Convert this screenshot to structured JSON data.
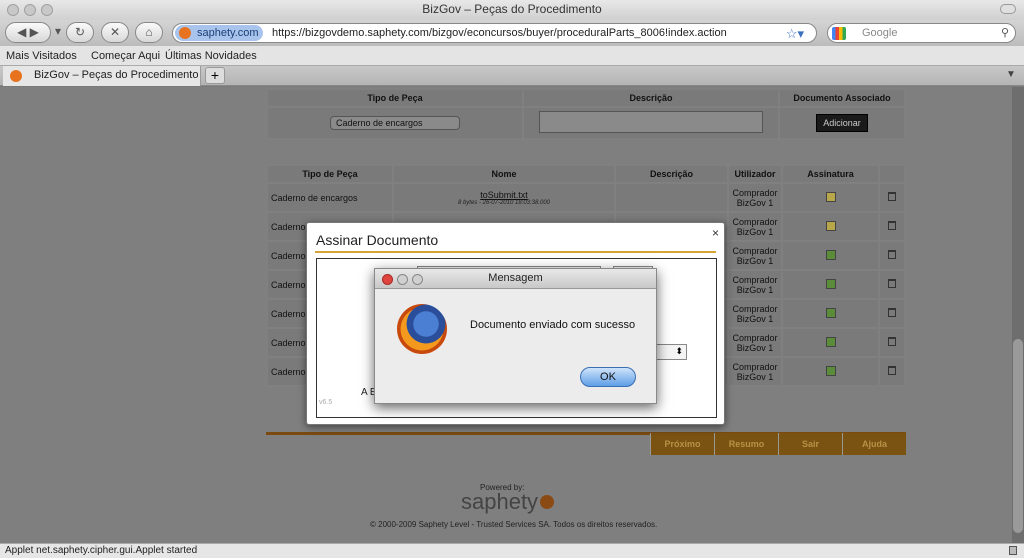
{
  "window": {
    "title": "BizGov – Peças do Procedimento"
  },
  "toolbar": {
    "back_icon": "back-arrow-icon",
    "forward_icon": "forward-arrow-icon",
    "site_name": "saphety.com",
    "url": "https://bizgovdemo.saphety.com/bizgov/econcursos/buyer/proceduralParts_8006!index.action",
    "search_placeholder": "Google"
  },
  "bookmarks": {
    "items": [
      "Mais Visitados",
      "Começar Aqui",
      "Últimas Novidades"
    ]
  },
  "tabs": {
    "active_title": "BizGov – Peças do Procedimento",
    "new_tab": "+"
  },
  "add_form": {
    "headers": [
      "Tipo de Peça",
      "Descrição",
      "Documento Associado"
    ],
    "select_value": "Caderno de encargos",
    "add_label": "Adicionar"
  },
  "parts_table": {
    "headers": [
      "Tipo de Peça",
      "Nome",
      "Descrição",
      "Utilizador",
      "Assinatura"
    ],
    "rows": [
      {
        "tipo": "Caderno de encargos",
        "nome": "toSubmit.txt",
        "info": "8 bytes - 26-07-2010 18:03:38.000",
        "user": "Comprador BizGov 1",
        "sig": "pending"
      },
      {
        "tipo": "Caderno",
        "nome": "",
        "info": "",
        "user": "Comprador BizGov 1",
        "sig": "pending"
      },
      {
        "tipo": "Caderno",
        "nome": "",
        "info": "",
        "user": "Comprador BizGov 1",
        "sig": "signed"
      },
      {
        "tipo": "Caderno",
        "nome": "",
        "info": "",
        "user": "Comprador BizGov 1",
        "sig": "signed"
      },
      {
        "tipo": "Caderno",
        "nome": "",
        "info": "",
        "user": "Comprador BizGov 1",
        "sig": "signed"
      },
      {
        "tipo": "Caderno",
        "nome": "",
        "info": "",
        "user": "Comprador BizGov 1",
        "sig": "signed"
      },
      {
        "tipo": "Caderno",
        "nome": "",
        "info": "",
        "user": "Comprador BizGov 1",
        "sig": "signed"
      }
    ]
  },
  "bottom_nav": {
    "items": [
      "Próximo",
      "Resumo",
      "Sair",
      "Ajuda"
    ]
  },
  "footer": {
    "powered_by": "Powered by:",
    "brand": "saphety",
    "copyright": "© 2000-2009 Saphety Level - Trusted Services SA. Todos os direitos reservados."
  },
  "sign_modal": {
    "title": "Assinar Documento",
    "close": "×",
    "footer_label": "A E",
    "version": "v6.5"
  },
  "message_dialog": {
    "title": "Mensagem",
    "text": "Documento enviado com sucesso",
    "ok_label": "OK"
  },
  "statusbar": {
    "text": "Applet net.saphety.cipher.gui.Applet started"
  }
}
